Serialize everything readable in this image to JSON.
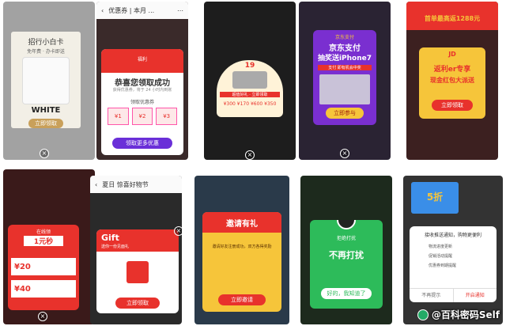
{
  "panels": [
    {
      "id": "p1",
      "card_title": "招行小白卡",
      "card_sub": "免年费 · 办卡即送",
      "card_brand": "WHITE",
      "cta": "立即领取"
    },
    {
      "id": "p2",
      "header_title": "优惠券 | 本月 ...",
      "badge": "福利",
      "title": "恭喜您领取成功",
      "sub": "获得优惠券，将于 24 小时内到账",
      "coupons_label": "领取优惠券",
      "amounts": [
        "¥1",
        "¥2",
        "¥3"
      ],
      "cta": "领取更多优惠"
    },
    {
      "id": "p3",
      "top": "19",
      "price_line": "¥300 ¥170 ¥600 ¥350",
      "banner": "超值好礼 · 立即领取"
    },
    {
      "id": "p4",
      "top": "京东支付",
      "title1": "京东支付",
      "title2": "抽奖送iPhone7",
      "note": "支付 即有机会中奖",
      "cta": "立即参与"
    },
    {
      "id": "p5",
      "header": "首单最高返1288元",
      "brand": "JD",
      "line1": "返利er专享",
      "line2": "现金红包大派送",
      "cta": "立即领取"
    },
    {
      "id": "p6",
      "top": "在线领",
      "title": "1元秒",
      "price": "1元秒",
      "items": [
        "¥20",
        "¥40"
      ],
      "amounts": [
        "20",
        "40"
      ]
    },
    {
      "id": "p7",
      "header_title": "夏日 惊喜好物节",
      "gift": "Gift",
      "sub": "送你一份见面礼",
      "cta": "立即领取"
    },
    {
      "id": "p8",
      "title": "邀请有礼",
      "body": "邀请好友注册成功，双方各得奖励",
      "cta": "立即邀请"
    },
    {
      "id": "p9",
      "top": "拒绝打扰",
      "title": "不再打扰",
      "cta": "好的，我知道了"
    },
    {
      "id": "p10",
      "badge": "5折",
      "title": "接收推送通知，购物更便利",
      "opts": [
        "物流进度更新",
        "促销活动提醒",
        "优惠券到期提醒"
      ],
      "left": "不再提示",
      "right": "开启通知"
    }
  ],
  "watermark": "@百科密码Self",
  "colors": {
    "red": "#e8322c",
    "gold": "#f6c53a",
    "purple": "#6a2fd8",
    "green": "#2dbb5a"
  }
}
